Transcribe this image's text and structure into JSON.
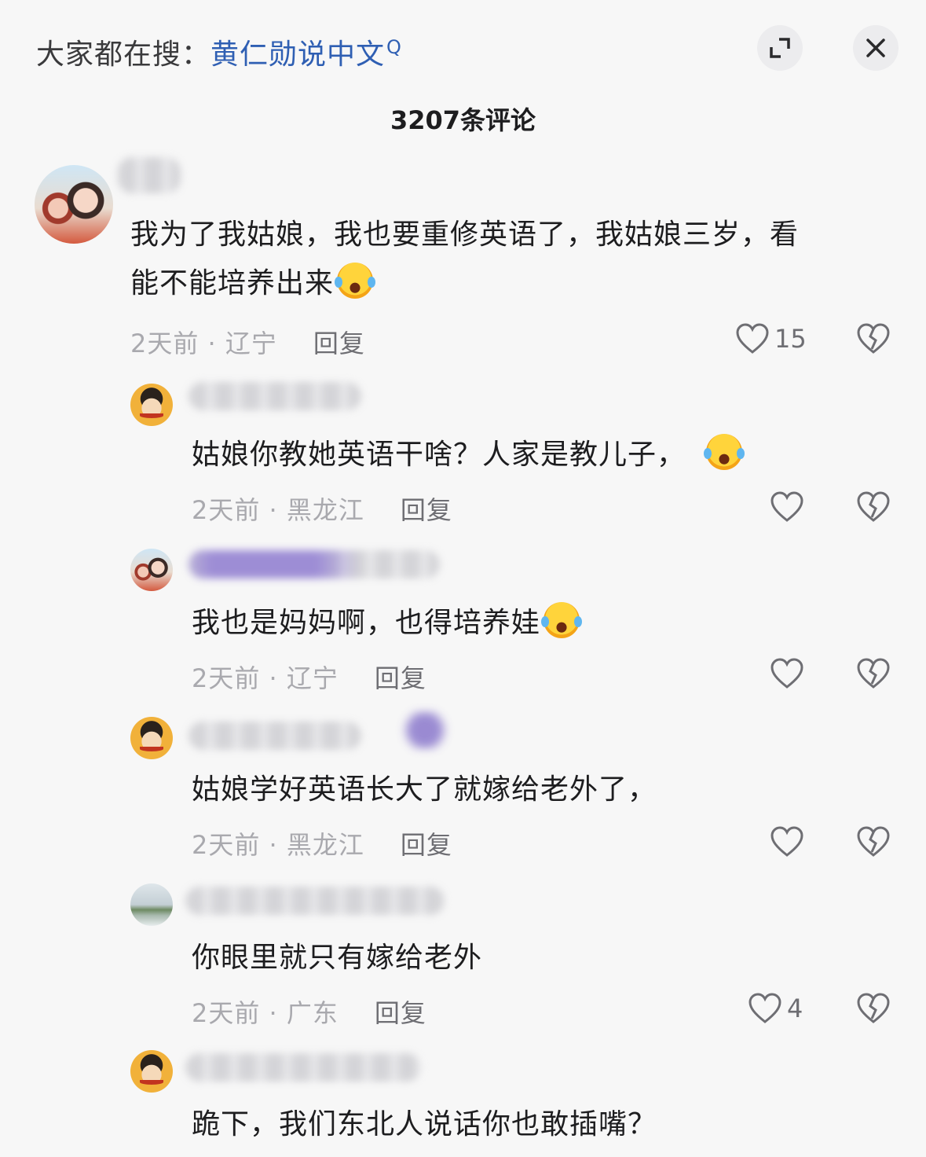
{
  "search_bar": {
    "prefix": "大家都在搜：",
    "term": "黄仁勋说中文",
    "search_glyph": "Q"
  },
  "header": {
    "comment_count": "3207条评论",
    "expand_icon": "expand-icon",
    "close_icon": "close-icon"
  },
  "comments": [
    {
      "text_line1": "我为了我姑娘，我也要重修英语了，我姑娘三岁，看",
      "text_line2": "能不能培养出来",
      "time": "2天前 · 辽宁",
      "reply": "回复",
      "likes": "15"
    },
    {
      "text": "姑娘你教她英语干啥？人家是教儿子，",
      "time": "2天前 · 黑龙江",
      "reply": "回复",
      "likes": ""
    },
    {
      "text": "我也是妈妈啊，也得培养娃",
      "time": "2天前 · 辽宁",
      "reply": "回复",
      "likes": ""
    },
    {
      "text": "姑娘学好英语长大了就嫁给老外了，",
      "time": "2天前 · 黑龙江",
      "reply": "回复",
      "likes": ""
    },
    {
      "text": "你眼里就只有嫁给老外",
      "time": "2天前 · 广东",
      "reply": "回复",
      "likes": "4"
    },
    {
      "text": "跪下，我们东北人说话你也敢插嘴？"
    }
  ],
  "colors": {
    "background": "#f7f7f7",
    "search_term": "#2f5fb3",
    "meta": "#a9a9ae"
  }
}
